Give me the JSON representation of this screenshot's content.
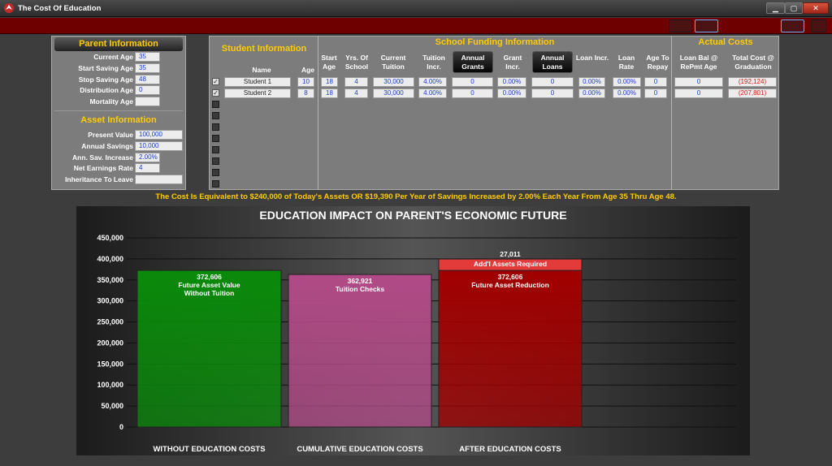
{
  "window": {
    "title": "The Cost Of Education",
    "min": "▁",
    "max": "▢",
    "close": "✕"
  },
  "parent": {
    "title": "Parent Information",
    "fields": [
      {
        "label": "Current Age",
        "value": "35"
      },
      {
        "label": "Start Saving Age",
        "value": "35"
      },
      {
        "label": "Stop Saving Age",
        "value": "48"
      },
      {
        "label": "Distribution Age",
        "value": "0"
      },
      {
        "label": "Mortality Age",
        "value": ""
      }
    ]
  },
  "asset": {
    "title": "Asset Information",
    "fields": [
      {
        "label": "Present Value",
        "value": "100,000"
      },
      {
        "label": "Annual Savings",
        "value": "10,000"
      },
      {
        "label": "Ann. Sav. Increase",
        "value": "2.00%"
      },
      {
        "label": "Net Earnings Rate",
        "value": "4"
      },
      {
        "label": "Inheritance To Leave",
        "value": ""
      }
    ]
  },
  "student": {
    "title": "Student Information",
    "col_name": "Name",
    "col_age": "Age"
  },
  "funding": {
    "title": "School Funding Information",
    "cols": [
      "Start Age",
      "Yrs. Of School",
      "Current Tuition",
      "Tuition Incr.",
      "Annual Grants",
      "Grant Incr.",
      "Annual Loans",
      "Loan Incr.",
      "Loan Rate",
      "Age To Repay"
    ]
  },
  "actual": {
    "title": "Actual Costs",
    "cols": [
      "Loan Bal @ RePmt Age",
      "Total Cost @ Graduation"
    ]
  },
  "students": [
    {
      "checked": true,
      "name": "Student 1",
      "age": "10",
      "start": "18",
      "yrs": "4",
      "tuition": "30,000",
      "tinc": "4.00%",
      "grants": "0",
      "ginc": "0.00%",
      "loans": "0",
      "linc": "0.00%",
      "lrate": "0.00%",
      "repay": "0",
      "loanbal": "0",
      "total": "(192,124)"
    },
    {
      "checked": true,
      "name": "Student 2",
      "age": "8",
      "start": "18",
      "yrs": "4",
      "tuition": "30,000",
      "tinc": "4.00%",
      "grants": "0",
      "ginc": "0.00%",
      "loans": "0",
      "linc": "0.00%",
      "lrate": "0.00%",
      "repay": "0",
      "loanbal": "0",
      "total": "(207,801)"
    },
    {
      "checked": false
    },
    {
      "checked": false
    },
    {
      "checked": false
    },
    {
      "checked": false
    },
    {
      "checked": false
    },
    {
      "checked": false
    },
    {
      "checked": false
    },
    {
      "checked": false
    }
  ],
  "summary": "The Cost Is Equivalent to $240,000 of Today's Assets OR $19,390 Per Year of Savings Increased by 2.00% Each Year From Age 35 Thru Age 48.",
  "chart_data": {
    "type": "bar",
    "title": "EDUCATION IMPACT ON PARENT'S ECONOMIC FUTURE",
    "ylim": [
      0,
      450000
    ],
    "yticks": [
      "0",
      "50,000",
      "100,000",
      "150,000",
      "200,000",
      "250,000",
      "300,000",
      "350,000",
      "400,000",
      "450,000"
    ],
    "grid": true,
    "categories": [
      "WITHOUT EDUCATION COSTS",
      "CUMULATIVE EDUCATION COSTS",
      "AFTER EDUCATION COSTS"
    ],
    "bars": [
      {
        "value": 372606,
        "label_value": "372,606",
        "label": "Future Asset Value\nWithout Tuition",
        "color": "#0a8a0a"
      },
      {
        "value": 362921,
        "label_value": "362,921",
        "label": "Tuition Checks",
        "color": "#b04a86"
      },
      {
        "value": 372606,
        "label_value": "372,606",
        "label": "Future Asset Reduction",
        "color": "#a10000",
        "stack": {
          "value": 27011,
          "label_value": "27,011",
          "label": "Add'l Assets Required",
          "color": "#e33a3a"
        }
      }
    ]
  }
}
